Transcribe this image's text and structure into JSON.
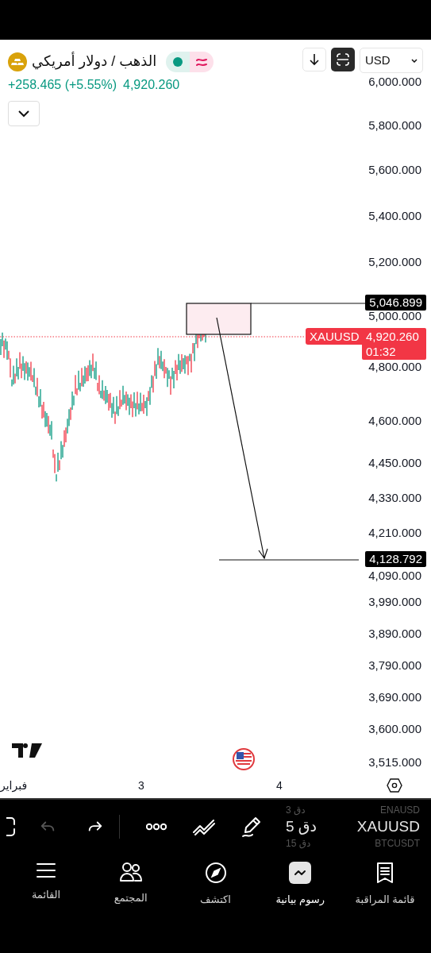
{
  "header": {
    "title": "الذهب / دولار أمريكي",
    "change": "+258.465 (+5.55%)",
    "price": "4,920.260",
    "currency": "USD"
  },
  "price_axis": [
    "6,000.000",
    "5,800.000",
    "5,600.000",
    "5,400.000",
    "5,200.000",
    "5,000.000",
    "4,800.000",
    "4,600.000",
    "4,450.000",
    "4,330.000",
    "4,210.000",
    "4,090.000",
    "3,990.000",
    "3,890.000",
    "3,790.000",
    "3,690.000",
    "3,600.000",
    "3,515.000"
  ],
  "markers": [
    {
      "kind": "zone",
      "price": "5,046.899"
    },
    {
      "kind": "target",
      "price": "4,128.792"
    }
  ],
  "last_price": {
    "symbol": "XAUUSD",
    "price": "4,920.260",
    "countdown": "01:32"
  },
  "time_axis": [
    "فبراير",
    "3",
    "4"
  ],
  "toolbar": [
    {
      "kind": "frame",
      "disabled": false
    },
    {
      "kind": "undo",
      "disabled": true
    },
    {
      "kind": "redo",
      "disabled": false
    },
    {
      "kind": "more",
      "disabled": false
    },
    {
      "kind": "lines",
      "disabled": false
    },
    {
      "kind": "pencil",
      "disabled": false
    }
  ],
  "symbol_picker": [
    {
      "symbol": "ENAUSD",
      "interval": "3 دق",
      "selected": false
    },
    {
      "symbol": "XAUUSD",
      "interval": "5 دق",
      "selected": true
    },
    {
      "symbol": "BTCUSDT",
      "interval": "15 دق",
      "selected": false
    }
  ],
  "nav": [
    {
      "kind": "watchlist",
      "label": "قائمة المراقبة",
      "selected": false
    },
    {
      "kind": "charts",
      "label": "رسوم بيانية",
      "selected": true
    },
    {
      "kind": "explore",
      "label": "اكتشف",
      "selected": false
    },
    {
      "kind": "community",
      "label": "المجتمع",
      "selected": false
    },
    {
      "kind": "menu",
      "label": "القائمة",
      "selected": false
    }
  ]
}
